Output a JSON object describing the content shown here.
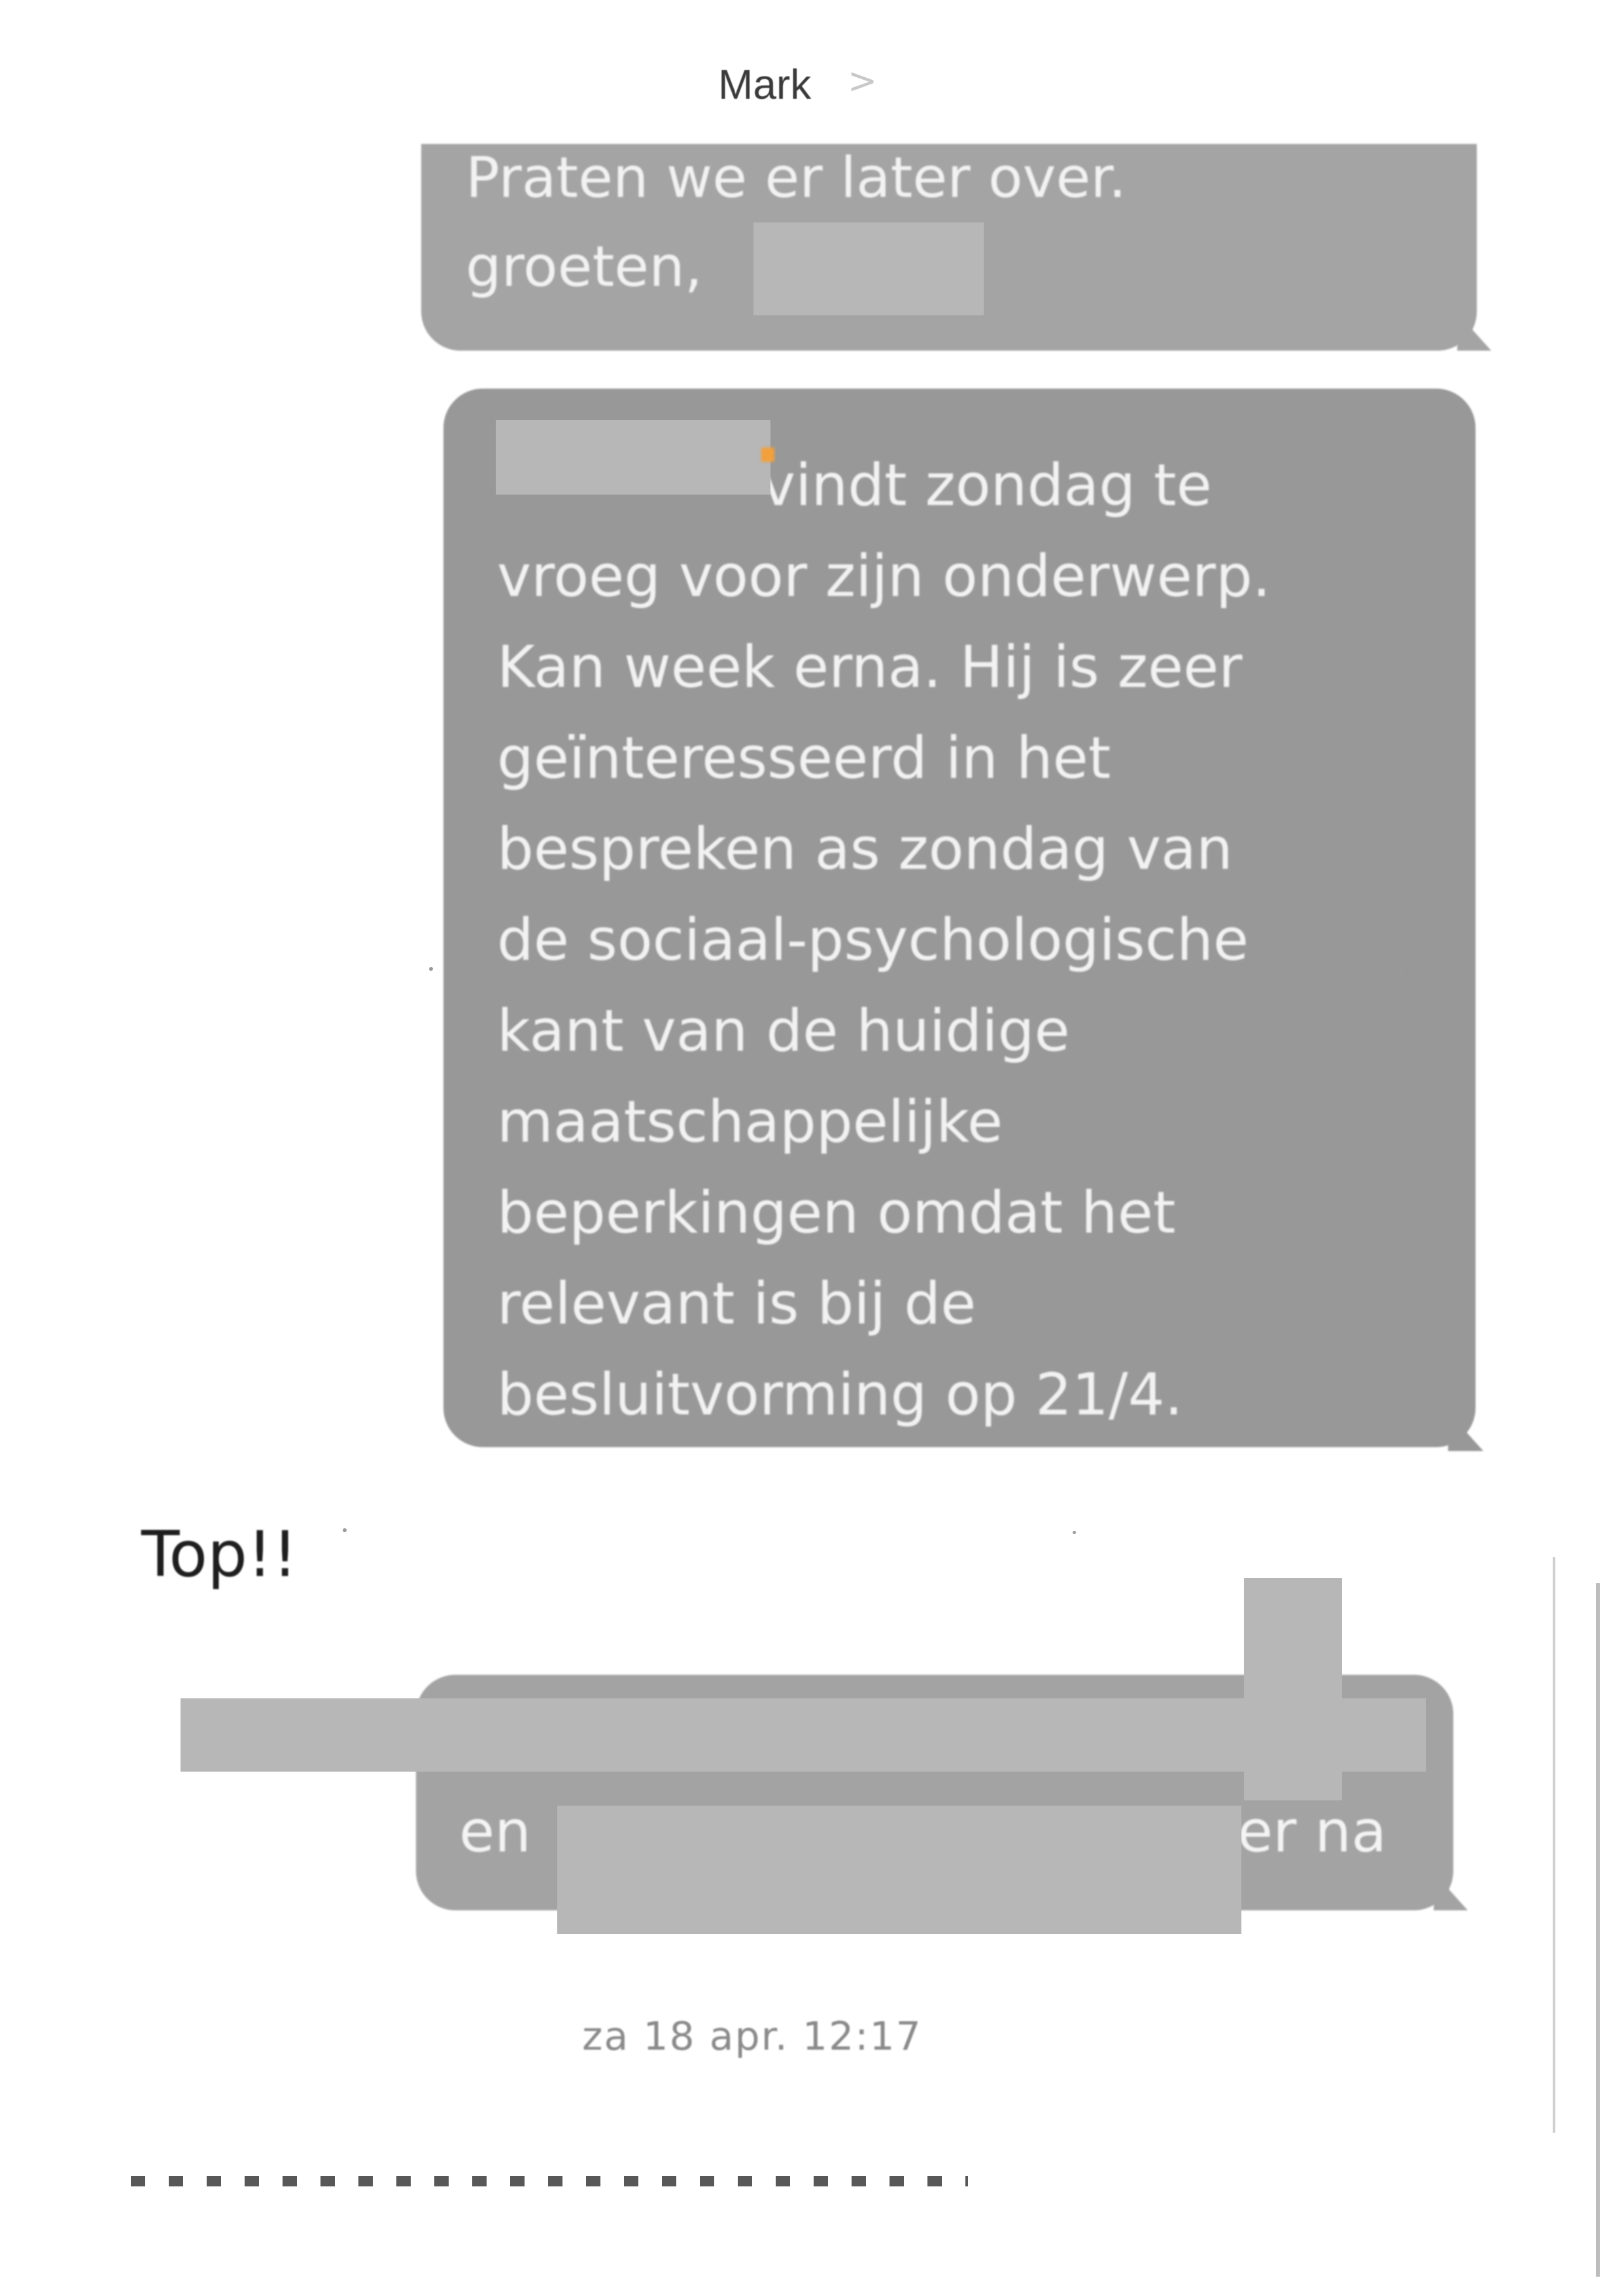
{
  "header": {
    "contact_name": "Mark",
    "chevron": ">"
  },
  "messages": [
    {
      "lines": [
        "Praten we er later over.",
        "groeten,"
      ]
    },
    {
      "lines": [
        "vindt zondag te",
        "vroeg voor zijn onderwerp.",
        "Kan week erna. Hij is zeer",
        "geïnteresseerd in het",
        "bespreken as zondag van",
        "de sociaal-psychologische",
        "kant van de huidige",
        "maatschappelijke",
        "beperkingen omdat het",
        "relevant is bij de",
        "besluitvorming op 21/4."
      ]
    },
    {
      "text_left": "en",
      "text_right": "er na"
    }
  ],
  "reply": {
    "text": "Top!!"
  },
  "timestamp": "za 18 apr. 12:17",
  "colors": {
    "bubble": "#9a9a9a",
    "bubble_text": "#f2f2f2",
    "redaction": "#b7b7b7"
  }
}
